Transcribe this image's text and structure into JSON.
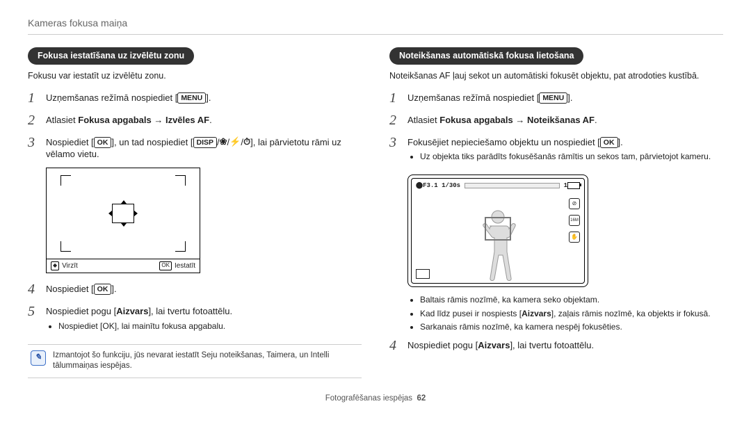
{
  "header": "Kameras fokusa maiņa",
  "footer": {
    "label": "Fotografēšanas iespējas",
    "page": "62"
  },
  "left": {
    "pill": "Fokusa iestatīšana uz izvēlētu zonu",
    "intro": "Fokusu var iestatīt uz izvēlētu zonu.",
    "steps": {
      "s1_a": "Uzņemšanas režīmā nospiediet [",
      "s1_b": "].",
      "menu": "MENU",
      "s2_a": "Atlasiet ",
      "s2_bold": "Fokusa apgabals → Izvēles AF",
      "s2_b": ".",
      "s3_a": "Nospiediet [",
      "s3_b": "], un tad nospiediet [",
      "s3_c": "], lai pārvietotu rāmi uz vēlamo vietu.",
      "ok": "OK",
      "disp": "DISP",
      "flower": "❀",
      "flash": "⚡",
      "timer": "⏱",
      "s4_a": "Nospiediet [",
      "s4_b": "].",
      "s5_a": "Nospiediet pogu [",
      "s5_bold": "Aizvars",
      "s5_b": "], lai tvertu fotoattēlu.",
      "sub5": "Nospiediet [OK], lai mainītu fokusa apgabalu."
    },
    "screen": {
      "move_icon_label": "Virzīt",
      "set_icon_label": "Iestatīt"
    },
    "note": "Izmantojot šo funkciju, jūs nevarat iestatīt Seju noteikšanas, Taimera, un Intelli tālummaiņas iespējas."
  },
  "right": {
    "pill": "Noteikšanas automātiskā fokusa lietošana",
    "intro": "Noteikšanas AF ļauj sekot un automātiski fokusēt objektu, pat atrodoties kustībā.",
    "steps": {
      "s1_a": "Uzņemšanas režīmā nospiediet [",
      "s1_b": "].",
      "menu": "MENU",
      "s2_a": "Atlasiet ",
      "s2_bold": "Fokusa apgabals → Noteikšanas AF",
      "s2_b": ".",
      "s3_a": "Fokusējiet nepieciešamo objektu un nospiediet [",
      "s3_b": "].",
      "ok": "OK",
      "sub3": "Uz objekta tiks parādīts fokusēšanās rāmītis un sekos tam, pārvietojot kameru.",
      "bullets": {
        "b1": "Baltais rāmis nozīmē, ka kamera seko objektam.",
        "b2_a": "Kad līdz pusei ir nospiests [",
        "b2_bold": "Aizvars",
        "b2_b": "], zaļais rāmis nozīmē, ka objekts ir fokusā.",
        "b3": "Sarkanais rāmis nozīmē, ka kamera nespēj fokusēties."
      },
      "s4_a": "Nospiediet pogu [",
      "s4_bold": "Aizvars",
      "s4_b": "], lai tvertu fotoattēlu."
    },
    "screen": {
      "readout": "F3.1  1/30s",
      "count": "1",
      "icon_mode": "⬤",
      "icon_flash": "⊘",
      "icon_size": "16M",
      "icon_stab": "✋"
    }
  }
}
